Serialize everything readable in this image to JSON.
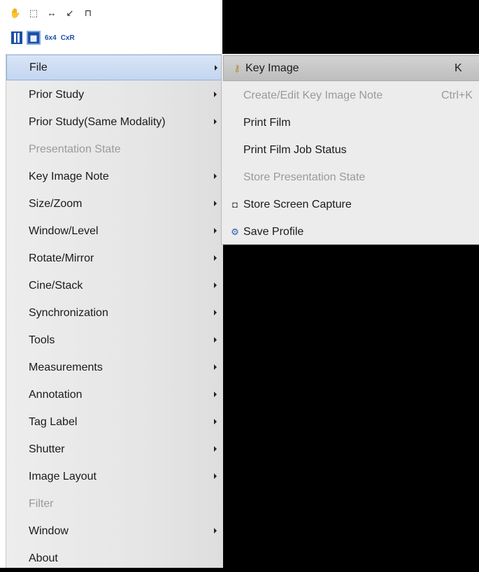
{
  "toolbar": {
    "row1_icons": [
      "hand-icon",
      "select-region-icon",
      "measure-distance-icon",
      "arrow-draw-icon",
      "cursor-tool-icon"
    ],
    "layout_label_1": "6x4",
    "layout_label_2": "CxR"
  },
  "menu": {
    "items": [
      {
        "label": "File",
        "submenu": true,
        "state": "selected"
      },
      {
        "label": "Prior Study",
        "submenu": true,
        "state": "normal"
      },
      {
        "label": "Prior Study(Same Modality)",
        "submenu": true,
        "state": "normal"
      },
      {
        "label": "Presentation State",
        "submenu": false,
        "state": "disabled"
      },
      {
        "label": "Key Image Note",
        "submenu": true,
        "state": "normal"
      },
      {
        "label": "Size/Zoom",
        "submenu": true,
        "state": "normal"
      },
      {
        "label": "Window/Level",
        "submenu": true,
        "state": "normal"
      },
      {
        "label": "Rotate/Mirror",
        "submenu": true,
        "state": "normal"
      },
      {
        "label": "Cine/Stack",
        "submenu": true,
        "state": "normal"
      },
      {
        "label": "Synchronization",
        "submenu": true,
        "state": "normal"
      },
      {
        "label": "Tools",
        "submenu": true,
        "state": "normal"
      },
      {
        "label": "Measurements",
        "submenu": true,
        "state": "normal"
      },
      {
        "label": "Annotation",
        "submenu": true,
        "state": "normal"
      },
      {
        "label": "Tag Label",
        "submenu": true,
        "state": "normal"
      },
      {
        "label": "Shutter",
        "submenu": true,
        "state": "normal"
      },
      {
        "label": "Image Layout",
        "submenu": true,
        "state": "normal"
      },
      {
        "label": "Filter",
        "submenu": false,
        "state": "disabled"
      },
      {
        "label": "Window",
        "submenu": true,
        "state": "normal"
      },
      {
        "label": "About",
        "submenu": false,
        "state": "normal"
      }
    ]
  },
  "file_submenu": {
    "items": [
      {
        "label": "Key Image",
        "shortcut": "K",
        "icon": "key-icon",
        "state": "selected"
      },
      {
        "label": "Create/Edit Key Image Note",
        "shortcut": "Ctrl+K",
        "icon": "",
        "state": "disabled"
      },
      {
        "label": "Print Film",
        "shortcut": "",
        "icon": "",
        "state": "normal"
      },
      {
        "label": "Print Film Job Status",
        "shortcut": "",
        "icon": "",
        "state": "normal"
      },
      {
        "label": "Store Presentation State",
        "shortcut": "",
        "icon": "",
        "state": "disabled"
      },
      {
        "label": "Store Screen Capture",
        "shortcut": "",
        "icon": "camera-icon",
        "state": "normal"
      },
      {
        "label": "Save Profile",
        "shortcut": "",
        "icon": "save-profile-icon",
        "state": "normal"
      }
    ]
  },
  "colors": {
    "accent": "#1c4fa8",
    "selected_bg": "#c3d5f0",
    "disabled_text": "#9a9a9a",
    "viewport_bg": "#000000"
  }
}
